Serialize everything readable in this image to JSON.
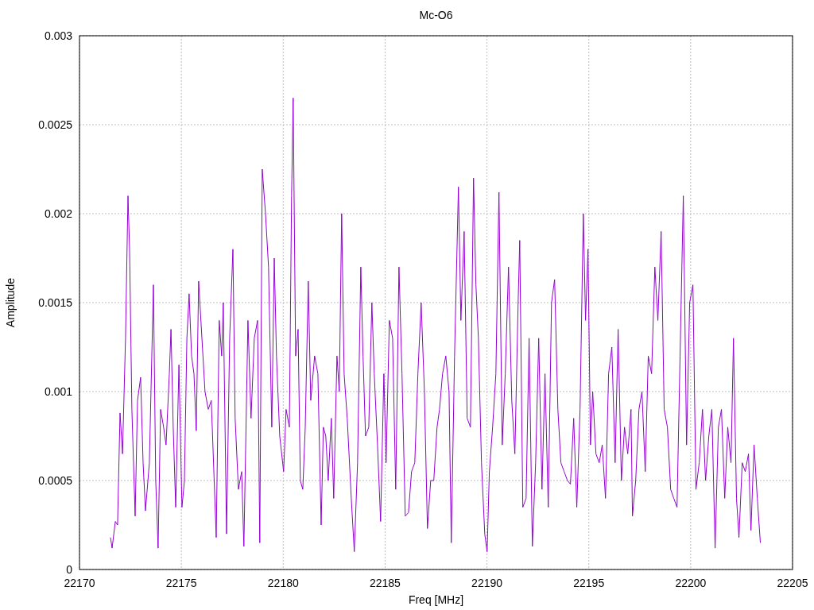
{
  "chart_data": {
    "type": "line",
    "grid": true,
    "title": "Mc-O6",
    "xlabel": "Freq [MHz]",
    "ylabel": "Amplitude",
    "xlim": [
      22170,
      22205
    ],
    "ylim": [
      0,
      0.003
    ],
    "xticks": [
      22170,
      22175,
      22180,
      22185,
      22190,
      22195,
      22200,
      22205
    ],
    "yticks": [
      {
        "value": 0,
        "label": "0"
      },
      {
        "value": 0.0005,
        "label": "0.0005"
      },
      {
        "value": 0.001,
        "label": "0.001"
      },
      {
        "value": 0.0015,
        "label": "0.0015"
      },
      {
        "value": 0.002,
        "label": "0.002"
      },
      {
        "value": 0.0025,
        "label": "0.0025"
      },
      {
        "value": 0.003,
        "label": "0.003"
      }
    ],
    "x": [
      22171.52,
      22171.6,
      22171.76,
      22171.87,
      22171.99,
      22172.11,
      22172.26,
      22172.38,
      22172.46,
      22172.57,
      22172.73,
      22172.85,
      22173.0,
      22173.12,
      22173.24,
      22173.43,
      22173.63,
      22173.74,
      22173.86,
      22173.98,
      22174.13,
      22174.25,
      22174.41,
      22174.49,
      22174.6,
      22174.72,
      22174.88,
      22175.03,
      22175.15,
      22175.27,
      22175.38,
      22175.5,
      22175.62,
      22175.73,
      22175.85,
      22176.01,
      22176.16,
      22176.32,
      22176.47,
      22176.71,
      22176.86,
      22176.98,
      22177.06,
      22177.22,
      22177.37,
      22177.53,
      22177.64,
      22177.8,
      22177.96,
      22178.07,
      22178.27,
      22178.42,
      22178.58,
      22178.74,
      22178.85,
      22178.97,
      22179.13,
      22179.28,
      22179.44,
      22179.56,
      22179.67,
      22179.83,
      22180.02,
      22180.14,
      22180.3,
      22180.41,
      22180.49,
      22180.61,
      22180.73,
      22180.84,
      22180.96,
      22181.08,
      22181.23,
      22181.35,
      22181.54,
      22181.7,
      22181.86,
      22181.97,
      22182.09,
      22182.21,
      22182.36,
      22182.48,
      22182.64,
      22182.75,
      22182.87,
      22182.99,
      22183.14,
      22183.34,
      22183.49,
      22183.65,
      22183.81,
      22183.92,
      22184.04,
      22184.2,
      22184.35,
      22184.47,
      22184.63,
      22184.78,
      22184.94,
      22185.05,
      22185.21,
      22185.37,
      22185.52,
      22185.68,
      22185.83,
      22185.99,
      22186.15,
      22186.3,
      22186.46,
      22186.61,
      22186.77,
      22186.93,
      22187.08,
      22187.24,
      22187.39,
      22187.55,
      22187.67,
      22187.82,
      22187.98,
      22188.14,
      22188.25,
      22188.41,
      22188.6,
      22188.72,
      22188.88,
      22189.03,
      22189.19,
      22189.34,
      22189.46,
      22189.58,
      22189.73,
      22189.89,
      22190.01,
      22190.12,
      22190.28,
      22190.44,
      22190.59,
      22190.75,
      22190.9,
      22191.06,
      22191.22,
      22191.37,
      22191.53,
      22191.61,
      22191.76,
      22191.92,
      22192.07,
      22192.23,
      22192.39,
      22192.54,
      22192.7,
      22192.85,
      22193.01,
      22193.17,
      22193.32,
      22193.48,
      22193.63,
      22193.79,
      22193.95,
      22194.1,
      22194.26,
      22194.41,
      22194.57,
      22194.73,
      22194.84,
      22194.96,
      22195.08,
      22195.19,
      22195.35,
      22195.51,
      22195.66,
      22195.82,
      22195.97,
      22196.13,
      22196.29,
      22196.44,
      22196.6,
      22196.75,
      22196.91,
      22197.07,
      22197.14,
      22197.3,
      22197.46,
      22197.61,
      22197.77,
      22197.92,
      22198.08,
      22198.24,
      22198.39,
      22198.55,
      22198.7,
      22198.86,
      22199.02,
      22199.17,
      22199.33,
      22199.48,
      22199.64,
      22199.8,
      22199.95,
      22200.11,
      22200.26,
      22200.42,
      22200.58,
      22200.73,
      22200.89,
      22201.04,
      22201.2,
      22201.36,
      22201.51,
      22201.67,
      22201.82,
      22201.98,
      22202.1,
      22202.25,
      22202.37,
      22202.53,
      22202.68,
      22202.84,
      22202.96,
      22203.11,
      22203.27,
      22203.42
    ],
    "series": [
      {
        "color": "#9400d3",
        "values": [
          0.00018,
          0.00012,
          0.00027,
          0.00025,
          0.00088,
          0.00065,
          0.0013,
          0.0021,
          0.0018,
          0.0009,
          0.0003,
          0.00095,
          0.00108,
          0.0006,
          0.00033,
          0.0006,
          0.0016,
          0.0005,
          0.00012,
          0.0009,
          0.0008,
          0.0007,
          0.0011,
          0.00135,
          0.0008,
          0.00035,
          0.00115,
          0.00035,
          0.0005,
          0.0013,
          0.00155,
          0.0012,
          0.0011,
          0.00078,
          0.00162,
          0.0013,
          0.001,
          0.0009,
          0.00095,
          0.00018,
          0.0014,
          0.0012,
          0.0015,
          0.0002,
          0.0013,
          0.0018,
          0.00085,
          0.00045,
          0.00055,
          0.00013,
          0.0014,
          0.00085,
          0.0013,
          0.0014,
          0.00015,
          0.00225,
          0.002,
          0.0017,
          0.0008,
          0.00175,
          0.0012,
          0.00075,
          0.00055,
          0.0009,
          0.0008,
          0.0021,
          0.00265,
          0.0012,
          0.00135,
          0.0005,
          0.00045,
          0.0008,
          0.00162,
          0.00095,
          0.0012,
          0.0011,
          0.00025,
          0.0008,
          0.00075,
          0.0005,
          0.00085,
          0.0004,
          0.0012,
          0.001,
          0.002,
          0.0011,
          0.00085,
          0.0004,
          0.0001,
          0.0006,
          0.0017,
          0.0012,
          0.00075,
          0.0008,
          0.0015,
          0.0011,
          0.0007,
          0.00027,
          0.0011,
          0.0006,
          0.0014,
          0.0013,
          0.00045,
          0.0017,
          0.0011,
          0.0003,
          0.00032,
          0.00055,
          0.0006,
          0.0011,
          0.0015,
          0.001,
          0.00023,
          0.0005,
          0.0005,
          0.0008,
          0.0009,
          0.0011,
          0.0012,
          0.001,
          0.00015,
          0.0012,
          0.00215,
          0.0014,
          0.0019,
          0.00085,
          0.0008,
          0.0022,
          0.0016,
          0.0013,
          0.0006,
          0.0002,
          0.0001,
          0.00055,
          0.0008,
          0.0011,
          0.00212,
          0.0007,
          0.0011,
          0.0017,
          0.00095,
          0.00065,
          0.0015,
          0.00185,
          0.00035,
          0.0004,
          0.0013,
          0.00013,
          0.0006,
          0.0013,
          0.00045,
          0.0011,
          0.00035,
          0.0015,
          0.00163,
          0.0009,
          0.0006,
          0.00055,
          0.0005,
          0.00048,
          0.00085,
          0.00035,
          0.0009,
          0.002,
          0.0014,
          0.0018,
          0.0007,
          0.001,
          0.00065,
          0.0006,
          0.0007,
          0.0004,
          0.0011,
          0.00125,
          0.0006,
          0.00135,
          0.0005,
          0.0008,
          0.00065,
          0.0009,
          0.0003,
          0.0005,
          0.0009,
          0.001,
          0.00055,
          0.0012,
          0.0011,
          0.0017,
          0.0014,
          0.0019,
          0.0009,
          0.0008,
          0.00045,
          0.0004,
          0.00035,
          0.0012,
          0.0021,
          0.0007,
          0.0015,
          0.0016,
          0.00045,
          0.0006,
          0.0009,
          0.0005,
          0.00075,
          0.0009,
          0.00012,
          0.0008,
          0.0009,
          0.0004,
          0.0008,
          0.0006,
          0.0013,
          0.0004,
          0.00018,
          0.0006,
          0.00055,
          0.00065,
          0.00022,
          0.0007,
          0.0004,
          0.00015
        ]
      }
    ]
  }
}
